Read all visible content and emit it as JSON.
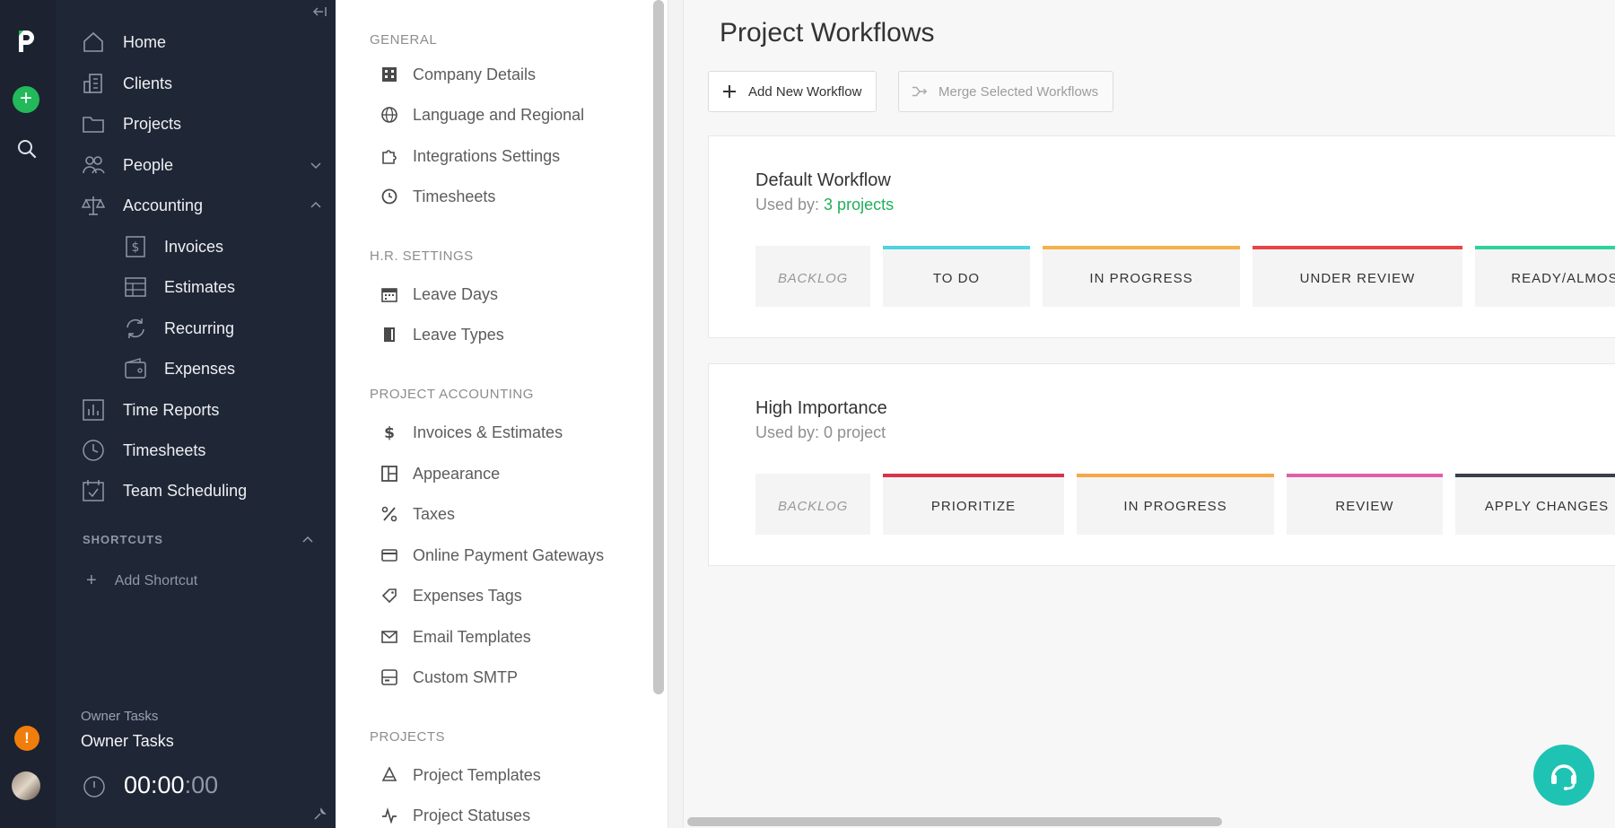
{
  "nav": {
    "items": [
      {
        "label": "Home",
        "icon": "home-icon"
      },
      {
        "label": "Clients",
        "icon": "building-icon"
      },
      {
        "label": "Projects",
        "icon": "folder-icon"
      },
      {
        "label": "People",
        "icon": "people-icon"
      },
      {
        "label": "Accounting",
        "icon": "scale-icon"
      },
      {
        "label": "Time Reports",
        "icon": "bar-chart-icon"
      },
      {
        "label": "Timesheets",
        "icon": "clock-icon"
      },
      {
        "label": "Team Scheduling",
        "icon": "calendar-check-icon"
      }
    ],
    "accounting_sub": [
      {
        "label": "Invoices",
        "icon": "invoice-dollar-icon"
      },
      {
        "label": "Estimates",
        "icon": "table-icon"
      },
      {
        "label": "Recurring",
        "icon": "refresh-icon"
      },
      {
        "label": "Expenses",
        "icon": "wallet-icon"
      }
    ],
    "shortcuts_heading": "SHORTCUTS",
    "add_shortcut": "Add Shortcut",
    "owner_tasks_caption": "Owner Tasks",
    "owner_tasks_title": "Owner Tasks",
    "timer_main": "00:00",
    "timer_ms": ":00",
    "alert_glyph": "!"
  },
  "settings": {
    "general_heading": "GENERAL",
    "general": [
      {
        "label": "Company Details",
        "icon": "building-grid-icon"
      },
      {
        "label": "Language and Regional",
        "icon": "globe-icon"
      },
      {
        "label": "Integrations Settings",
        "icon": "puzzle-icon"
      },
      {
        "label": "Timesheets",
        "icon": "clock-icon"
      }
    ],
    "hr_heading": "H.R. SETTINGS",
    "hr": [
      {
        "label": "Leave Days",
        "icon": "calendar-icon"
      },
      {
        "label": "Leave Types",
        "icon": "door-icon"
      }
    ],
    "pa_heading": "PROJECT ACCOUNTING",
    "pa": [
      {
        "label": "Invoices & Estimates",
        "icon": "dollar-icon"
      },
      {
        "label": "Appearance",
        "icon": "layout-icon"
      },
      {
        "label": "Taxes",
        "icon": "percent-icon"
      },
      {
        "label": "Online Payment Gateways",
        "icon": "credit-card-icon"
      },
      {
        "label": "Expenses Tags",
        "icon": "tag-icon"
      },
      {
        "label": "Email Templates",
        "icon": "mail-icon"
      },
      {
        "label": "Custom SMTP",
        "icon": "server-icon"
      }
    ],
    "projects_heading": "PROJECTS",
    "projects": [
      {
        "label": "Project Templates",
        "icon": "template-icon"
      },
      {
        "label": "Project Statuses",
        "icon": "activity-icon"
      }
    ]
  },
  "main": {
    "title": "Project Workflows",
    "add_button": "Add New Workflow",
    "merge_button": "Merge Selected Workflows",
    "workflows": [
      {
        "title": "Default Workflow",
        "used_by_prefix": "Used by: ",
        "used_by_value": "3 projects",
        "used_by_linked": true,
        "stages": [
          {
            "label": "BACKLOG",
            "color": "",
            "backlog": true
          },
          {
            "label": "TO DO",
            "color": "#4fd3e0"
          },
          {
            "label": "IN PROGRESS",
            "color": "#f6b04a"
          },
          {
            "label": "UNDER REVIEW",
            "color": "#e84545"
          },
          {
            "label": "READY/ALMOST",
            "color": "#2ed39a"
          }
        ]
      },
      {
        "title": "High Importance",
        "used_by_prefix": "Used by: ",
        "used_by_value": "0 project",
        "used_by_linked": false,
        "stages": [
          {
            "label": "BACKLOG",
            "color": "",
            "backlog": true
          },
          {
            "label": "PRIORITIZE",
            "color": "#d8334a"
          },
          {
            "label": "IN PROGRESS",
            "color": "#f6a84a"
          },
          {
            "label": "REVIEW",
            "color": "#e05fa8"
          },
          {
            "label": "APPLY CHANGES",
            "color": "#3a3f4a"
          }
        ]
      }
    ]
  },
  "colors": {
    "rail_bg": "#1c2230",
    "nav_bg": "#1f2636",
    "accent_green": "#23b85a",
    "link_green": "#1fb05a",
    "help_teal": "#1fc3b3",
    "alert_orange": "#f07d0c"
  }
}
